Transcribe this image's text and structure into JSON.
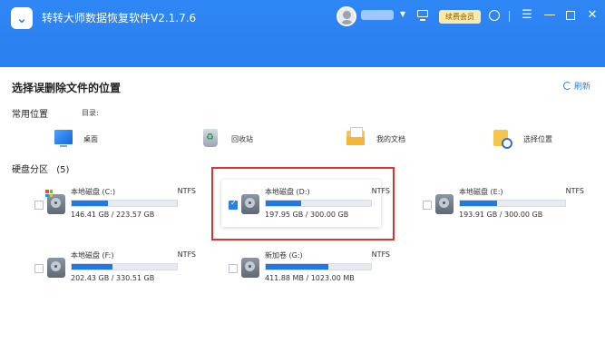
{
  "app": {
    "logo_glyph": "⌄",
    "title": "转转大师数据恢复软件V2.1.7.6",
    "vip_label": "续费会员",
    "accent_color": "#2a7fee"
  },
  "titlebar_icons": [
    "avatar",
    "monitor-icon",
    "help-icon",
    "menu-icon",
    "minimize-icon",
    "maximize-icon",
    "close-icon"
  ],
  "main": {
    "heading": "选择误删除文件的位置",
    "refresh_label": "刷新"
  },
  "common_locations": {
    "title": "常用位置",
    "dir_label": "目录:",
    "items": [
      {
        "label": "桌面",
        "icon": "desktop-icon"
      },
      {
        "label": "回收站",
        "icon": "recycle-bin-icon"
      },
      {
        "label": "我的文档",
        "icon": "documents-folder-icon"
      },
      {
        "label": "选择位置",
        "icon": "choose-location-icon"
      }
    ]
  },
  "partitions": {
    "title": "硬盘分区",
    "count": "(5)",
    "items": [
      {
        "name": "本地磁盘 (C:)",
        "fs": "NTFS",
        "size": "146.41 GB / 223.57 GB",
        "used_fraction": 0.345,
        "checked": false,
        "system": true
      },
      {
        "name": "本地磁盘 (D:)",
        "fs": "NTFS",
        "size": "197.95 GB / 300.00 GB",
        "used_fraction": 0.34,
        "checked": true,
        "system": false
      },
      {
        "name": "本地磁盘 (E:)",
        "fs": "NTFS",
        "size": "193.91 GB / 300.00 GB",
        "used_fraction": 0.353,
        "checked": false,
        "system": false
      },
      {
        "name": "本地磁盘 (F:)",
        "fs": "NTFS",
        "size": "202.43 GB / 330.51 GB",
        "used_fraction": 0.387,
        "checked": false,
        "system": false
      },
      {
        "name": "新加卷 (G:)",
        "fs": "NTFS",
        "size": "411.88 MB / 1023.00 MB",
        "used_fraction": 0.597,
        "checked": false,
        "system": false
      }
    ]
  }
}
